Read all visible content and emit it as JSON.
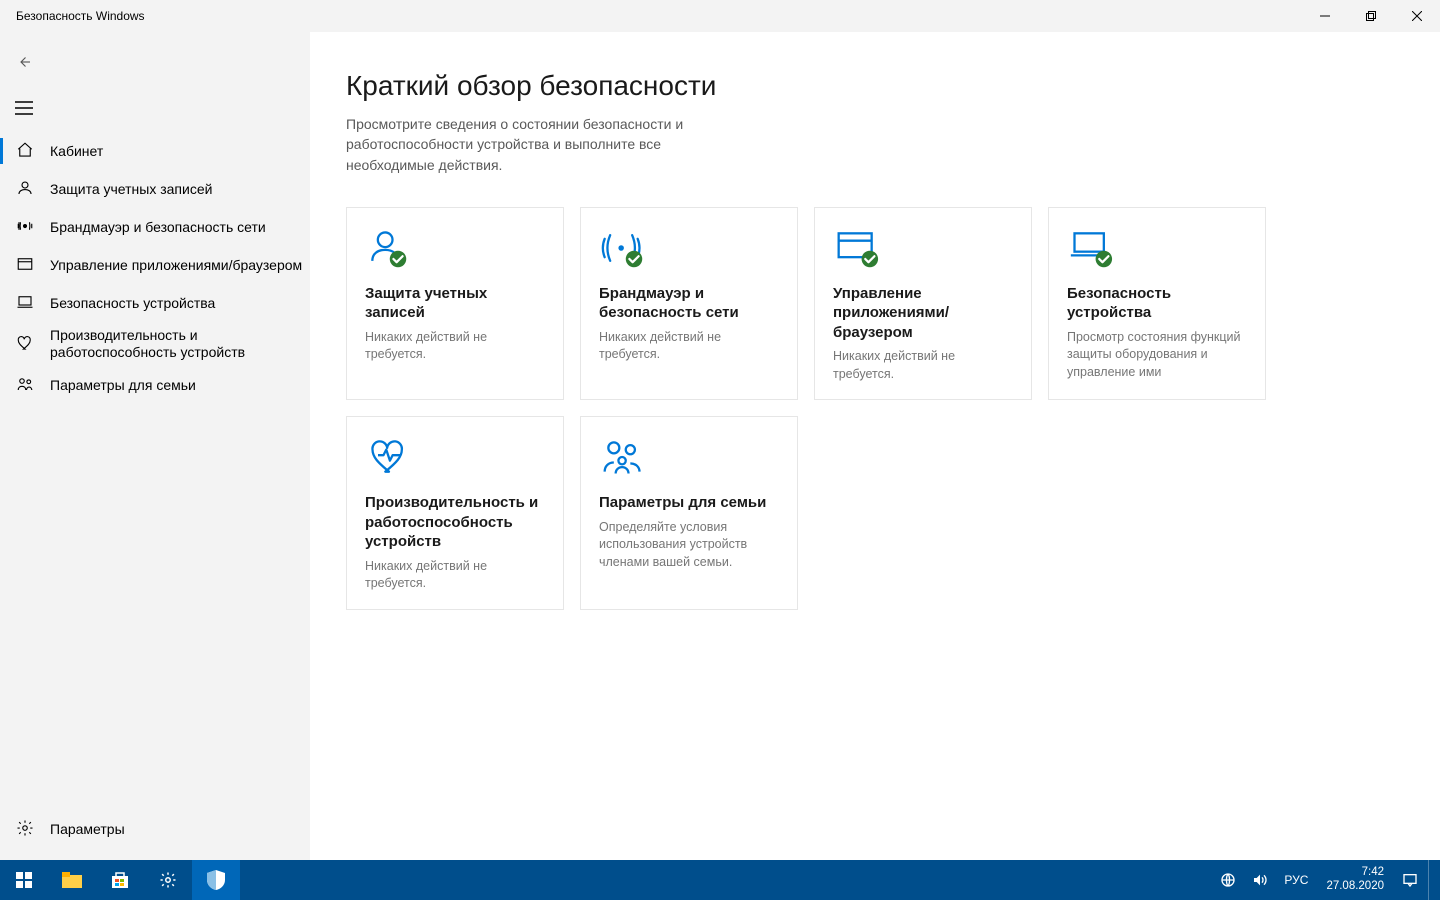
{
  "window": {
    "title": "Безопасность Windows"
  },
  "sidebar": {
    "items": [
      {
        "label": "Кабинет"
      },
      {
        "label": "Защита учетных записей"
      },
      {
        "label": "Брандмауэр и безопасность сети"
      },
      {
        "label": "Управление приложениями/браузером"
      },
      {
        "label": "Безопасность устройства"
      },
      {
        "label_line1": "Производительность и",
        "label_line2": "работоспособность устройств"
      },
      {
        "label": "Параметры для семьи"
      }
    ],
    "settings_label": "Параметры"
  },
  "page": {
    "title": "Краткий обзор безопасности",
    "subtitle": "Просмотрите сведения о состоянии безопасности и работоспособности устройства и выполните все необходимые действия."
  },
  "cards": [
    {
      "title": "Защита учетных записей",
      "desc": "Никаких действий не требуется."
    },
    {
      "title": "Брандмауэр и безопасность сети",
      "desc": "Никаких действий не требуется."
    },
    {
      "title": "Управление приложениями/браузером",
      "desc": "Никаких действий не требуется."
    },
    {
      "title": "Безопасность устройства",
      "desc": "Просмотр состояния функций защиты оборудования и управление ими"
    },
    {
      "title": "Производительность и работоспособность устройств",
      "desc": "Никаких действий не требуется."
    },
    {
      "title": "Параметры для семьи",
      "desc": "Определяйте условия использования устройств членами вашей семьи."
    }
  ],
  "taskbar": {
    "lang": "РУС",
    "time": "7:42",
    "date": "27.08.2020"
  }
}
